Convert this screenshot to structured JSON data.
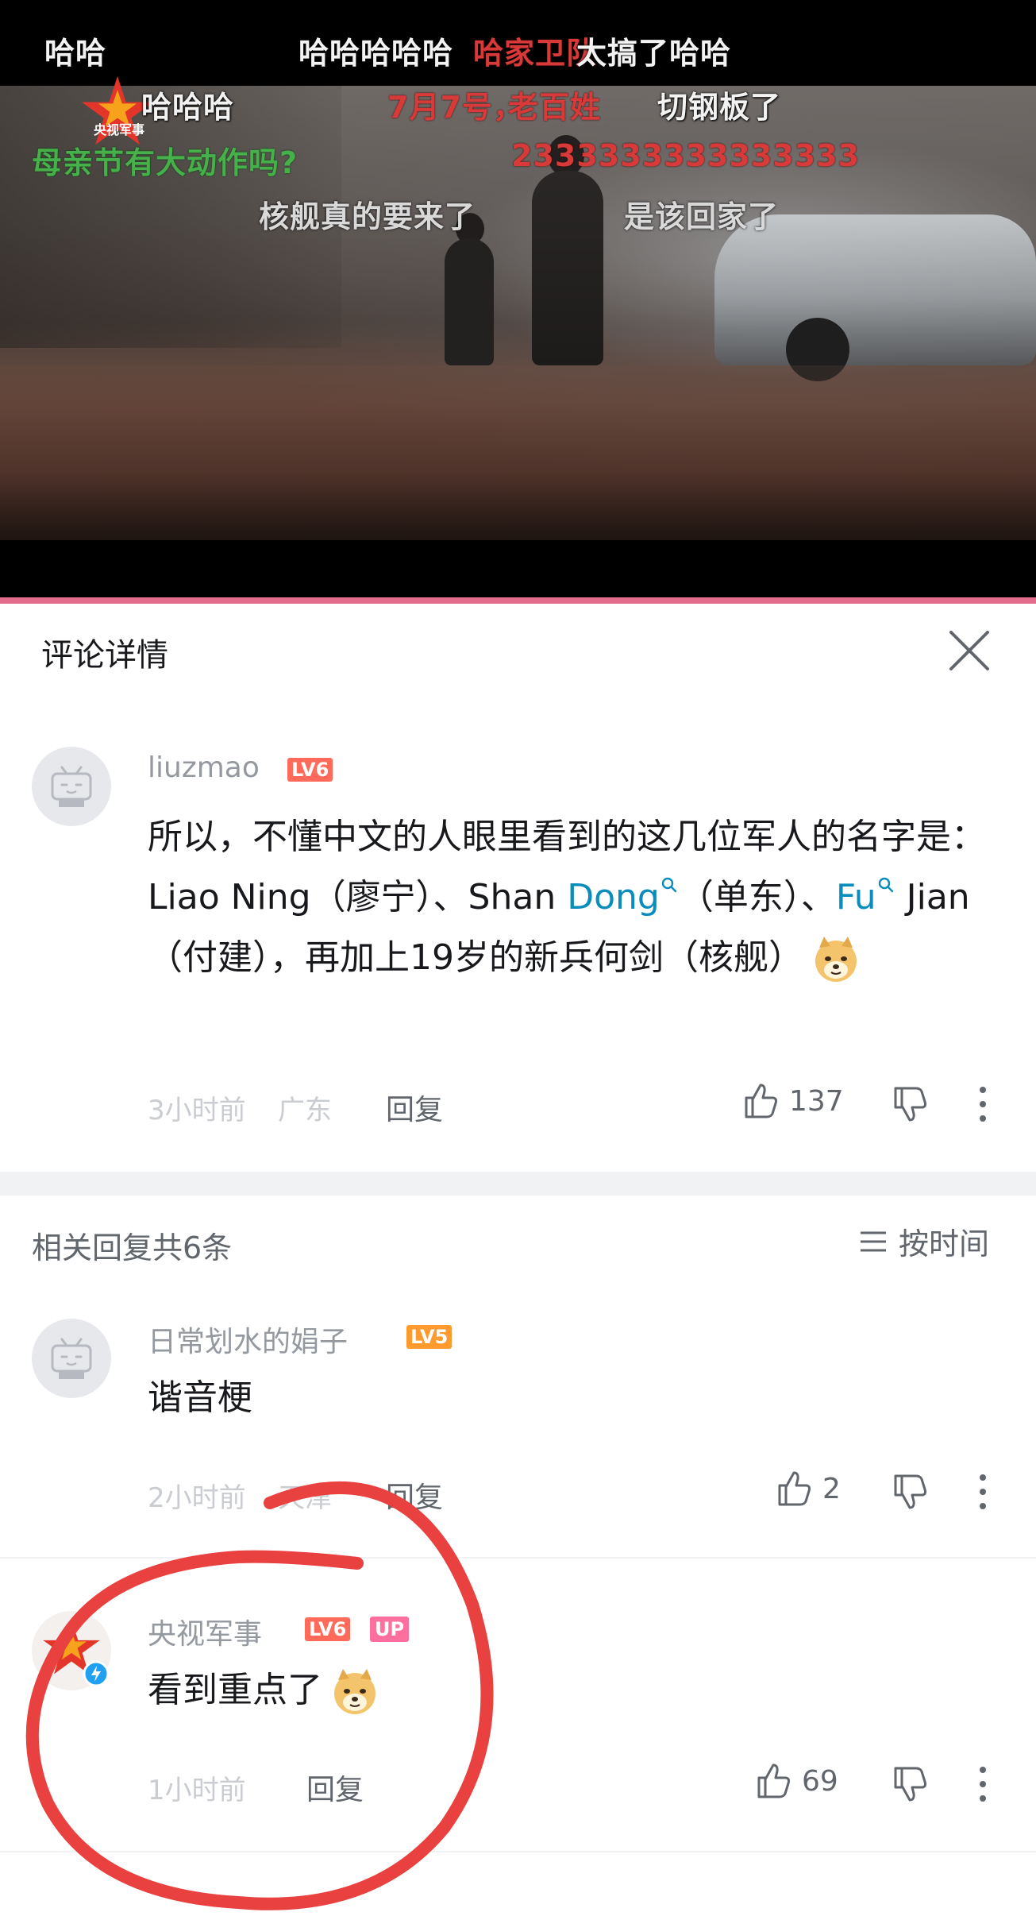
{
  "video": {
    "danmaku": [
      {
        "text": "哈哈",
        "style": "white"
      },
      {
        "text": "哈哈哈哈哈",
        "style": "white"
      },
      {
        "text": "哈家卫队",
        "style": "red"
      },
      {
        "text": "太搞了哈哈",
        "style": "white"
      },
      {
        "text": "哈哈哈",
        "style": "white"
      },
      {
        "text": "7月7号，",
        "style": "red"
      },
      {
        "text": "老百姓",
        "style": "red"
      },
      {
        "text": "切钢板了",
        "style": "white"
      },
      {
        "text": "母亲节有大动作吗?",
        "style": "green"
      },
      {
        "text": "2333333333333333",
        "style": "red"
      },
      {
        "text": "核舰真的要来了",
        "style": "gray"
      },
      {
        "text": "是该回家了",
        "style": "gray"
      }
    ],
    "channel_logo_text": "央视军事",
    "progress_fraction": 1.0,
    "colors": {
      "progress": "#e36b8b",
      "danmaku_red": "#d83a3a",
      "danmaku_green": "#46b04a"
    }
  },
  "panel": {
    "title": "评论详情",
    "close_icon": "close-icon"
  },
  "main_comment": {
    "username": "liuzmao",
    "level": "LV6",
    "text_parts": {
      "p1": "所以，不懂中文的人眼里看到的这几位军人的名字是：Liao Ning（廖宁）、Shan ",
      "link1": "Dong",
      "p2": "（单东）、",
      "link2": "Fu",
      "p3": " Jian（付建），再加上19岁的新兵何剑（核舰）"
    },
    "time": "3小时前",
    "location": "广东",
    "reply_label": "回复",
    "likes": "137"
  },
  "replies_header": {
    "count_label": "相关回复共6条",
    "sort_label": "按时间"
  },
  "replies": [
    {
      "username": "日常划水的娟子",
      "level": "LV5",
      "text": "谐音梗",
      "time": "2小时前",
      "location": "天津",
      "reply_label": "回复",
      "likes": "2"
    },
    {
      "username": "央视军事",
      "level": "LV6",
      "up_badge": "UP",
      "text": "看到重点了",
      "time": "1小时前",
      "reply_label": "回复",
      "likes": "69"
    }
  ]
}
